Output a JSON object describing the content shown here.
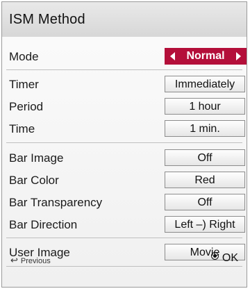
{
  "title": "ISM Method",
  "mode": {
    "label": "Mode",
    "value": "Normal"
  },
  "timer": {
    "label": "Timer",
    "value": "Immediately"
  },
  "period": {
    "label": "Period",
    "value": "1 hour"
  },
  "time": {
    "label": "Time",
    "value": "1 min."
  },
  "bar_image": {
    "label": "Bar Image",
    "value": "Off"
  },
  "bar_color": {
    "label": "Bar Color",
    "value": "Red"
  },
  "bar_transparency": {
    "label": "Bar Transparency",
    "value": "Off"
  },
  "bar_direction": {
    "label": "Bar Direction",
    "value": "Left –) Right"
  },
  "user_image": {
    "label": "User Image",
    "value": "Movie"
  },
  "footer": {
    "previous_label": "Previous",
    "ok_label": "OK"
  },
  "colors": {
    "mode_highlight": "#b40f3a"
  },
  "icons": {
    "previous": "return-arrow-icon",
    "ok": "ok-button-icon",
    "mode_left": "triangle-left-icon",
    "mode_right": "triangle-right-icon"
  }
}
